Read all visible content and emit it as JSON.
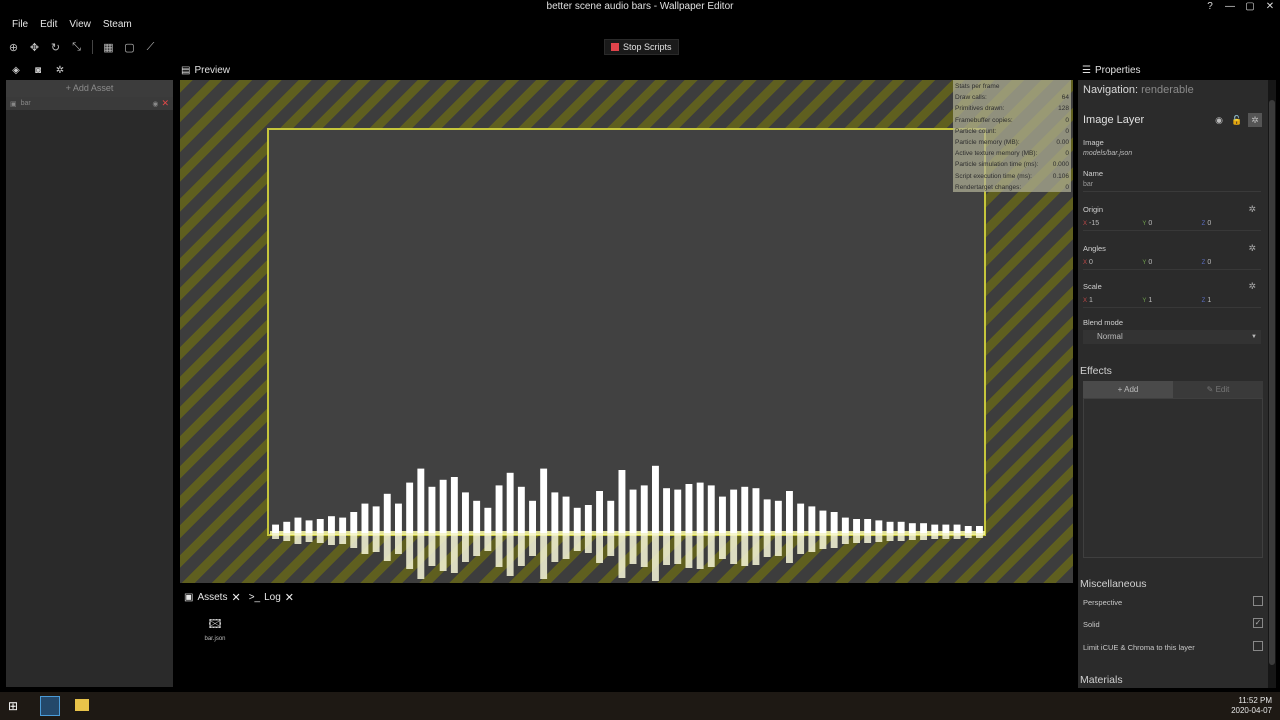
{
  "window": {
    "title": "better scene audio bars - Wallpaper Editor"
  },
  "menu": [
    "File",
    "Edit",
    "View",
    "Steam"
  ],
  "toolbar": {
    "stop_label": "Stop Scripts"
  },
  "left_panel": {
    "add_asset": "Add Asset",
    "layers": [
      {
        "name": "bar"
      }
    ]
  },
  "preview": {
    "tab_label": "Preview"
  },
  "stats": [
    {
      "label": "Stats per frame",
      "value": ""
    },
    {
      "label": "Draw calls:",
      "value": "64"
    },
    {
      "label": "Primitives drawn:",
      "value": "128"
    },
    {
      "label": "Framebuffer copies:",
      "value": "0"
    },
    {
      "label": "Particle count:",
      "value": "0"
    },
    {
      "label": "Particle memory (MB):",
      "value": "0.00"
    },
    {
      "label": "Active texture memory (MB):",
      "value": "0"
    },
    {
      "label": "Particle simulation time (ms):",
      "value": "0.000"
    },
    {
      "label": "Script execution time (ms):",
      "value": "0.106"
    },
    {
      "label": "Rendertarget changes:",
      "value": "0"
    }
  ],
  "audio_bars": [
    0.12,
    0.16,
    0.22,
    0.18,
    0.2,
    0.24,
    0.22,
    0.3,
    0.42,
    0.38,
    0.56,
    0.42,
    0.72,
    0.92,
    0.66,
    0.76,
    0.8,
    0.58,
    0.46,
    0.36,
    0.68,
    0.86,
    0.66,
    0.46,
    0.92,
    0.58,
    0.52,
    0.36,
    0.4,
    0.6,
    0.46,
    0.9,
    0.62,
    0.68,
    0.96,
    0.64,
    0.62,
    0.7,
    0.72,
    0.68,
    0.52,
    0.62,
    0.66,
    0.64,
    0.48,
    0.46,
    0.6,
    0.42,
    0.38,
    0.32,
    0.3,
    0.22,
    0.2,
    0.2,
    0.18,
    0.16,
    0.16,
    0.14,
    0.14,
    0.12,
    0.12,
    0.12,
    0.1,
    0.1
  ],
  "bottom_tabs": [
    {
      "label": "Assets"
    },
    {
      "label": "Log"
    }
  ],
  "assets": [
    {
      "name": "bar.json"
    }
  ],
  "properties": {
    "tab_label": "Properties",
    "nav_prefix": "Navigation:",
    "nav_mode": "renderable",
    "layer_title": "Image Layer",
    "image_label": "Image",
    "image_value": "models/bar.json",
    "name_label": "Name",
    "name_value": "bar",
    "origin_label": "Origin",
    "origin": {
      "x": "-15",
      "y": "0",
      "z": "0"
    },
    "angles_label": "Angles",
    "angles": {
      "x": "0",
      "y": "0",
      "z": "0"
    },
    "scale_label": "Scale",
    "scale": {
      "x": "1",
      "y": "1",
      "z": "1"
    },
    "blend_label": "Blend mode",
    "blend_value": "Normal",
    "effects_label": "Effects",
    "effects_add": "Add",
    "effects_edit": "Edit",
    "misc_label": "Miscellaneous",
    "perspective_label": "Perspective",
    "solid_label": "Solid",
    "icue_label": "Limit iCUE & Chroma to this layer",
    "materials_label": "Materials",
    "perspective_checked": false,
    "solid_checked": true,
    "icue_checked": false
  },
  "taskbar": {
    "time": "11:52 PM",
    "date": "2020-04-07"
  },
  "colors": {
    "frame": "#c6c63c",
    "stripe": "#5f5f1f",
    "accent_red": "#e0434a"
  }
}
